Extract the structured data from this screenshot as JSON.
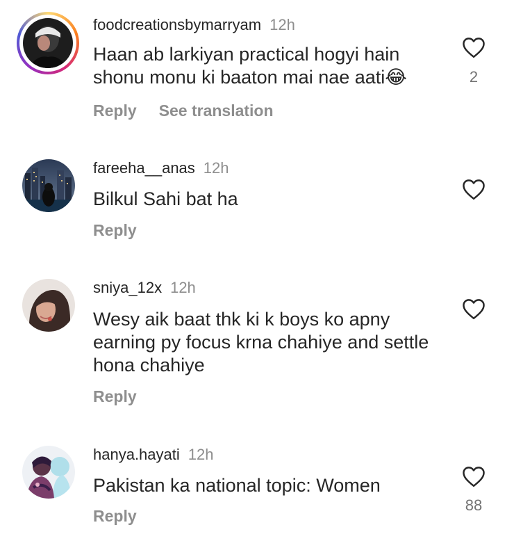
{
  "comments": [
    {
      "username": "foodcreationsbymarryam",
      "time": "12h",
      "text": "Haan ab larkiyan practical hogyi hain shonu monu ki baaton mai nae aati😂",
      "reply_label": "Reply",
      "translation_label": "See translation",
      "likes": "2",
      "has_story_ring": true
    },
    {
      "username": "fareeha__anas",
      "time": "12h",
      "text": "Bilkul Sahi bat ha",
      "reply_label": "Reply",
      "likes": ""
    },
    {
      "username": "sniya_12x",
      "time": "12h",
      "text": "Wesy aik baat thk ki k boys ko apny earning py focus krna chahiye and settle hona chahiye",
      "reply_label": "Reply",
      "likes": ""
    },
    {
      "username": "hanya.hayati",
      "time": "12h",
      "text": "Pakistan ka national topic: Women",
      "reply_label": "Reply",
      "likes": "88"
    }
  ],
  "icons": {
    "like": "heart-outline-icon"
  },
  "colors": {
    "text": "#262626",
    "muted": "#8e8e8e",
    "story_ring": [
      "#feda75",
      "#fa7e1e",
      "#d62976",
      "#962fbf",
      "#4f5bd5"
    ]
  }
}
